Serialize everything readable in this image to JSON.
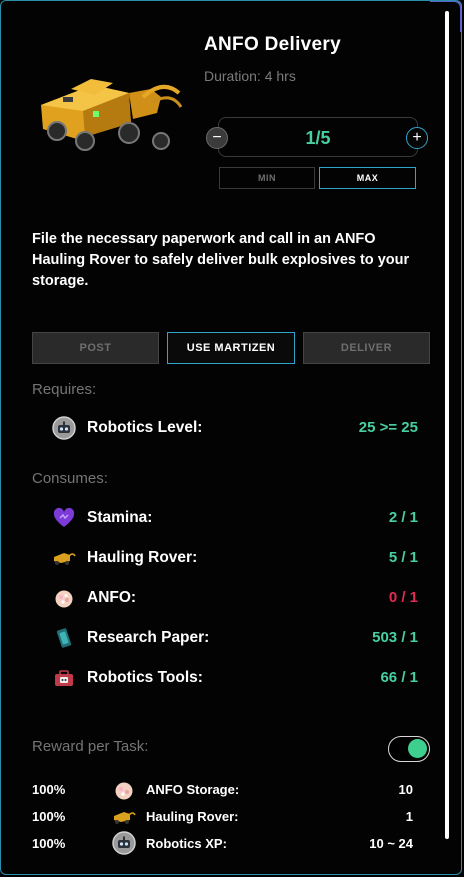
{
  "task": {
    "title": "ANFO Delivery",
    "duration": "Duration: 4 hrs",
    "description": "File the necessary paperwork and call in an ANFO Hauling Rover to safely deliver bulk explosives to your storage.",
    "image_icon": "hauling-rover-illustration"
  },
  "quantity": {
    "value": "1/5",
    "minus_label": "−",
    "plus_label": "+",
    "min_label": "MIN",
    "max_label": "MAX"
  },
  "actions": {
    "post": "POST",
    "use_martizen": "USE MARTIZEN",
    "deliver": "DELIVER"
  },
  "requires": {
    "title": "Requires:",
    "items": [
      {
        "icon": "robot-icon",
        "label": "Robotics Level:",
        "value": "25 >= 25",
        "status": "ok"
      }
    ]
  },
  "consumes": {
    "title": "Consumes:",
    "items": [
      {
        "icon": "heart-icon",
        "label": "Stamina:",
        "value": "2 / 1",
        "status": "ok"
      },
      {
        "icon": "rover-icon",
        "label": "Hauling Rover:",
        "value": "5 / 1",
        "status": "ok"
      },
      {
        "icon": "anfo-icon",
        "label": "ANFO:",
        "value": "0 / 1",
        "status": "insufficient"
      },
      {
        "icon": "research-paper-icon",
        "label": "Research Paper:",
        "value": "503 / 1",
        "status": "ok"
      },
      {
        "icon": "toolbox-icon",
        "label": "Robotics Tools:",
        "value": "66 / 1",
        "status": "ok"
      }
    ]
  },
  "rewards": {
    "title": "Reward per Task:",
    "toggle_on": true,
    "items": [
      {
        "pct": "100%",
        "icon": "anfo-icon",
        "label": "ANFO Storage:",
        "value": "10"
      },
      {
        "pct": "100%",
        "icon": "rover-icon",
        "label": "Hauling Rover:",
        "value": "1"
      },
      {
        "pct": "100%",
        "icon": "robot-icon",
        "label": "Robotics XP:",
        "value": "10 ~ 24"
      }
    ]
  },
  "colors": {
    "accent": "#2fa6c9",
    "ok": "#48cfa0",
    "insufficient": "#e02c55",
    "toggle": "#3ecf8e"
  }
}
